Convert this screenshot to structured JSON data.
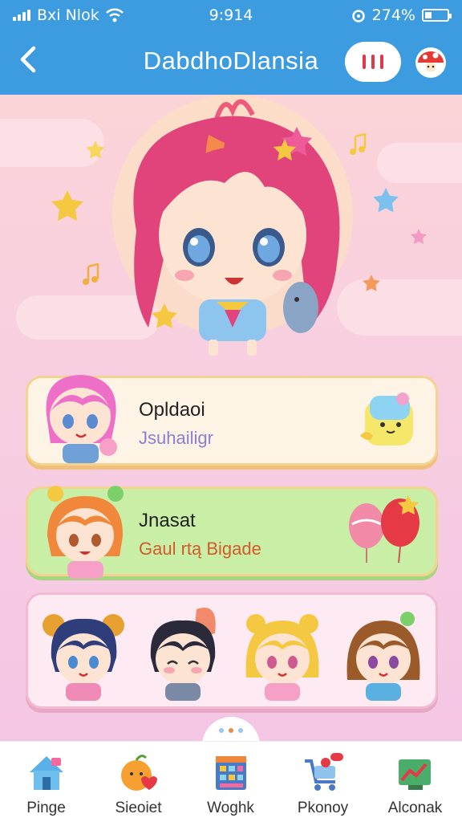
{
  "status_bar": {
    "carrier": "Bxi Nlok",
    "time": "9:914",
    "battery": "274%"
  },
  "app_bar": {
    "title": "DabdhoDlansia"
  },
  "cards": [
    {
      "title": "Opldaoi",
      "subtitle": "Jsuhailigr"
    },
    {
      "title": "Jnasat",
      "subtitle": "Gaul rtą Bigade"
    }
  ],
  "tabs": [
    {
      "label": "Pinge",
      "icon": "home-icon"
    },
    {
      "label": "Sieoiet",
      "icon": "fruit-icon"
    },
    {
      "label": "Woghk",
      "icon": "building-icon"
    },
    {
      "label": "Pkonoy",
      "icon": "shopping-cart-icon"
    },
    {
      "label": "Alconak",
      "icon": "chart-icon"
    }
  ],
  "colors": {
    "accent": "#3d9ce0",
    "menu_red": "#e03a4a",
    "card_yellow": "#fdf4e6",
    "card_green": "#c9eea6",
    "card_pink": "#fdeaf3"
  },
  "page_indicator": {
    "count": 2,
    "active": 1
  }
}
